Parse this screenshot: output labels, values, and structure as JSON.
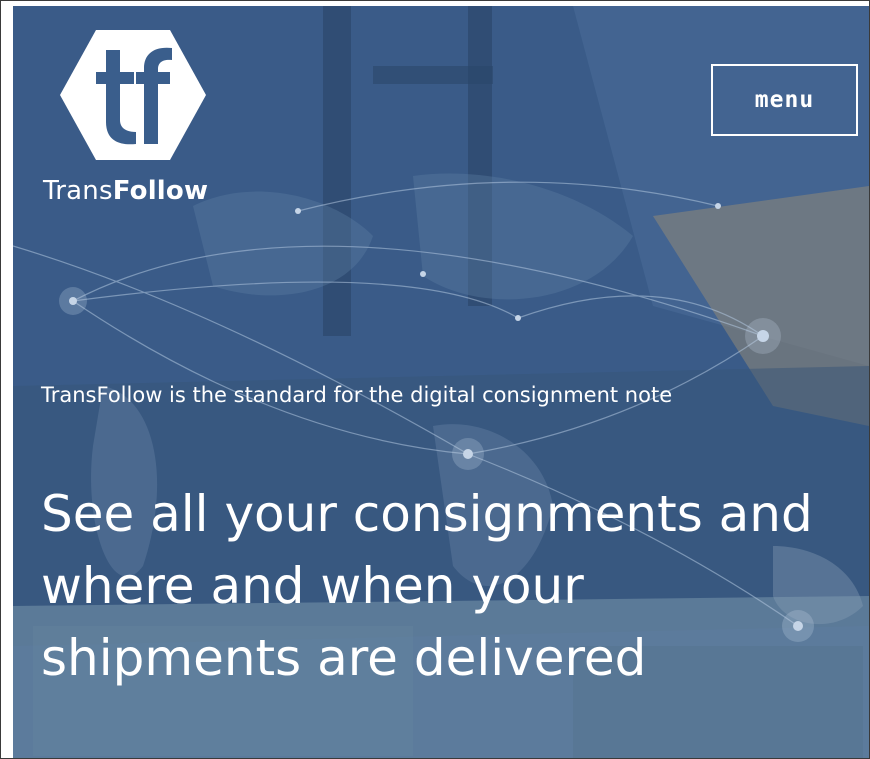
{
  "brand": {
    "logo_text": "tf",
    "name_regular": "Trans",
    "name_bold": "Follow"
  },
  "header": {
    "menu_label": "menu"
  },
  "hero": {
    "tagline": "TransFollow is the standard for the digital consignment note",
    "headline": "See all your consignments and where and when your shipments are delivered"
  },
  "colors": {
    "hero_overlay": "#3f6290",
    "text": "#ffffff"
  }
}
